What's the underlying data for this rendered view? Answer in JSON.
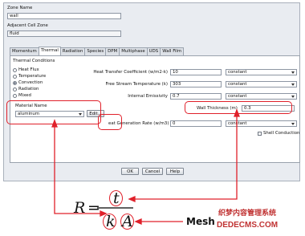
{
  "zone": {
    "name_label": "Zone Name",
    "name_value": "wall"
  },
  "adjacent": {
    "label": "Adjacent Cell Zone",
    "value": "fluid"
  },
  "tabs": [
    "Momentum",
    "Thermal",
    "Radiation",
    "Species",
    "DPM",
    "Multiphase",
    "UDS",
    "Wall Film"
  ],
  "thermal": {
    "group_label": "Thermal Conditions",
    "options": [
      "Heat Flux",
      "Temperature",
      "Convection",
      "Radiation",
      "Mixed"
    ],
    "selected": "Convection",
    "material_label": "Material Name",
    "material_value": "aluminum",
    "edit_button": "Edit...",
    "htc_label": "Heat Transfer Coefficient (w/m2-k)",
    "htc_value": "10",
    "fst_label": "Free Stream Temperature (k)",
    "fst_value": "303",
    "emis_label": "Internal Emissivity",
    "emis_value": "0.7",
    "thick_label": "Wall Thickness (m)",
    "thick_value": "0.3",
    "hgr_label": "eat Generation Rate (w/m3)",
    "hgr_value": "0",
    "profile": "constant",
    "shell_label": "Shell Conduction"
  },
  "buttons": {
    "ok": "OK",
    "cancel": "Cancel",
    "help": "Help"
  },
  "annotation": {
    "R": "R",
    "eq": "=",
    "t": "t",
    "k": "k",
    "A": "A",
    "mesh": "Mesh",
    "watermark_cn": "织梦内容管理系统",
    "watermark_url": "DEDECMS.COM",
    "accent": "#e0202a"
  }
}
